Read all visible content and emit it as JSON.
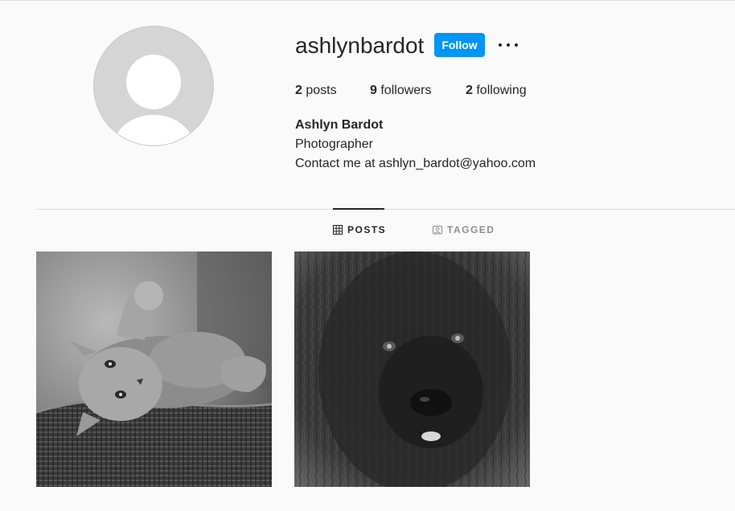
{
  "profile": {
    "username": "ashlynbardot",
    "follow_label": "Follow",
    "stats": {
      "posts_count": "2",
      "posts_label": "posts",
      "followers_count": "9",
      "followers_label": "followers",
      "following_count": "2",
      "following_label": "following"
    },
    "full_name": "Ashlyn Bardot",
    "bio_line1": "Photographer",
    "bio_line2": "Contact me at ashlyn_bardot@yahoo.com"
  },
  "tabs": [
    {
      "label": "POSTS",
      "icon": "grid-icon",
      "active": true
    },
    {
      "label": "TAGGED",
      "icon": "tagged-icon",
      "active": false
    }
  ],
  "posts": [
    {
      "subject": "kitten-photo"
    },
    {
      "subject": "dog-photo"
    }
  ],
  "colors": {
    "accent": "#0095f6",
    "text": "#262626",
    "muted": "#8e8e8e",
    "background": "#fafafa"
  }
}
